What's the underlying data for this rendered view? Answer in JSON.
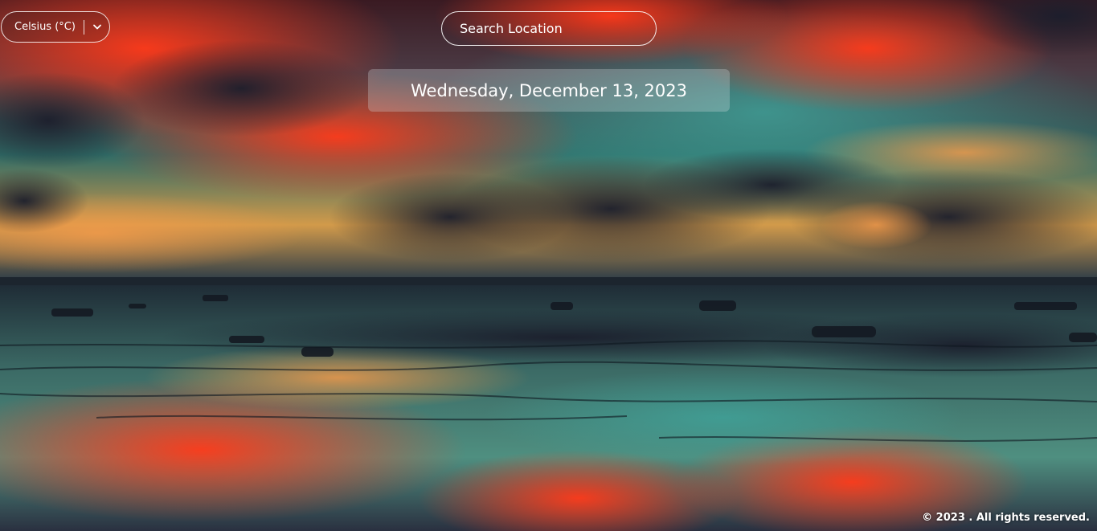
{
  "unit_selector": {
    "label": "Celsius (°C)",
    "chevron_icon": "chevron-down-icon"
  },
  "search": {
    "placeholder": "Search Location"
  },
  "date": {
    "text": "Wednesday, December 13, 2023"
  },
  "footer": {
    "text": "© 2023 . All rights reserved."
  }
}
